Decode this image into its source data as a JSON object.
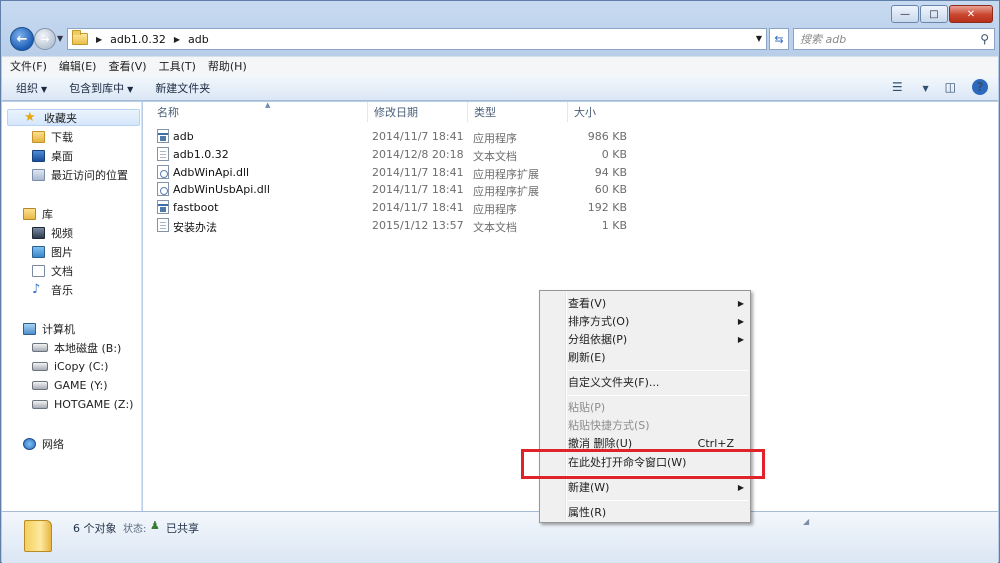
{
  "address": {
    "crumbs": [
      "adb1.0.32",
      "adb"
    ],
    "search_placeholder": "搜索 adb"
  },
  "menubar": [
    "文件(F)",
    "编辑(E)",
    "查看(V)",
    "工具(T)",
    "帮助(H)"
  ],
  "toolbar": {
    "organize": "组织",
    "include_library": "包含到库中",
    "new_folder": "新建文件夹"
  },
  "navpane": {
    "favorites": "收藏夹",
    "downloads": "下载",
    "desktop": "桌面",
    "recent": "最近访问的位置",
    "libraries": "库",
    "videos": "视频",
    "pictures": "图片",
    "documents": "文档",
    "music": "音乐",
    "computer": "计算机",
    "drive_b": "本地磁盘 (B:)",
    "drive_c": "iCopy (C:)",
    "drive_y": "GAME (Y:)",
    "drive_z": "HOTGAME (Z:)",
    "network": "网络"
  },
  "columns": {
    "name": "名称",
    "date": "修改日期",
    "type": "类型",
    "size": "大小"
  },
  "files": [
    {
      "name": "adb",
      "date": "2014/11/7 18:41",
      "type": "应用程序",
      "size": "986 KB",
      "icon": "exe"
    },
    {
      "name": "adb1.0.32",
      "date": "2014/12/8 20:18",
      "type": "文本文档",
      "size": "0 KB",
      "icon": "txt"
    },
    {
      "name": "AdbWinApi.dll",
      "date": "2014/11/7 18:41",
      "type": "应用程序扩展",
      "size": "94 KB",
      "icon": "dll"
    },
    {
      "name": "AdbWinUsbApi.dll",
      "date": "2014/11/7 18:41",
      "type": "应用程序扩展",
      "size": "60 KB",
      "icon": "dll"
    },
    {
      "name": "fastboot",
      "date": "2014/11/7 18:41",
      "type": "应用程序",
      "size": "192 KB",
      "icon": "exe"
    },
    {
      "name": "安装办法",
      "date": "2015/1/12 13:57",
      "type": "文本文档",
      "size": "1 KB",
      "icon": "txt"
    }
  ],
  "context_menu": {
    "view": "查看(V)",
    "sort": "排序方式(O)",
    "group": "分组依据(P)",
    "refresh": "刷新(E)",
    "customize": "自定义文件夹(F)...",
    "paste": "粘贴(P)",
    "paste_shortcut": "粘贴快捷方式(S)",
    "undo": "撤消 删除(U)",
    "undo_shortcut": "Ctrl+Z",
    "open_cmd": "在此处打开命令窗口(W)",
    "new": "新建(W)",
    "properties": "属性(R)"
  },
  "status": {
    "count": "6 个对象",
    "state_label": "状态:",
    "state_value": "已共享"
  },
  "colors": {
    "highlight": "#e0232b",
    "accent": "#1d5fb7"
  }
}
